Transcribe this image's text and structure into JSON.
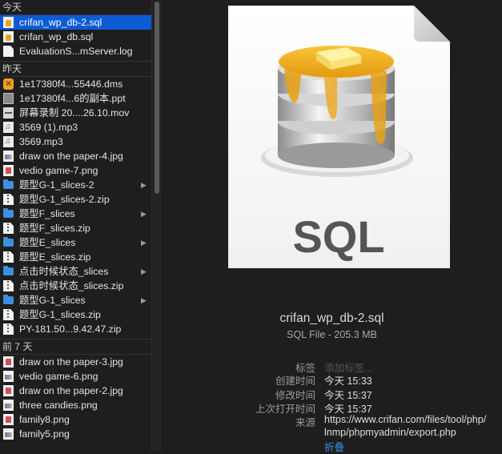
{
  "sidebar": {
    "sections": [
      {
        "header": "今天",
        "items": [
          {
            "label": "crifan_wp_db-2.sql",
            "icon": "sql-file-icon",
            "selected": true
          },
          {
            "label": "crifan_wp_db.sql",
            "icon": "sql-file-icon"
          },
          {
            "label": "EvaluationS...mServer.log",
            "icon": "document-icon"
          }
        ]
      },
      {
        "header": "昨天",
        "items": [
          {
            "label": "1e17380f4...55446.dms",
            "icon": "dms-file-icon"
          },
          {
            "label": "1e17380f4...6的副本.ppt",
            "icon": "ppt-file-icon"
          },
          {
            "label": "屏幕录制 20....26.10.mov",
            "icon": "movie-file-icon"
          },
          {
            "label": "3569 (1).mp3",
            "icon": "audio-file-icon"
          },
          {
            "label": "3569.mp3",
            "icon": "audio-file-icon"
          },
          {
            "label": "draw on the paper-4.jpg",
            "icon": "image-file-icon"
          },
          {
            "label": "vedio game-7.png",
            "icon": "image-file-icon"
          },
          {
            "label": "题型G-1_slices-2",
            "icon": "folder-icon",
            "folder": true
          },
          {
            "label": "题型G-1_slices-2.zip",
            "icon": "zip-file-icon"
          },
          {
            "label": "题型F_slices",
            "icon": "folder-icon",
            "folder": true
          },
          {
            "label": "题型F_slices.zip",
            "icon": "zip-file-icon"
          },
          {
            "label": "题型E_slices",
            "icon": "folder-icon",
            "folder": true
          },
          {
            "label": "题型E_slices.zip",
            "icon": "zip-file-icon"
          },
          {
            "label": "点击时候状态_slices",
            "icon": "folder-icon",
            "folder": true
          },
          {
            "label": "点击时候状态_slices.zip",
            "icon": "zip-file-icon"
          },
          {
            "label": "题型G-1_slices",
            "icon": "folder-icon",
            "folder": true
          },
          {
            "label": "题型G-1_slices.zip",
            "icon": "zip-file-icon"
          },
          {
            "label": "PY-181.50...9.42.47.zip",
            "icon": "zip-file-icon"
          }
        ]
      },
      {
        "header": "前 7 天",
        "items": [
          {
            "label": "draw on the paper-3.jpg",
            "icon": "image-file-icon"
          },
          {
            "label": "vedio game-6.png",
            "icon": "image-file-icon"
          },
          {
            "label": "draw on the paper-2.jpg",
            "icon": "image-file-icon"
          },
          {
            "label": "three candies.png",
            "icon": "image-file-icon"
          },
          {
            "label": "family8.png",
            "icon": "image-file-icon"
          },
          {
            "label": "family5.png",
            "icon": "image-file-icon"
          }
        ]
      }
    ]
  },
  "preview": {
    "icon_text": "SQL",
    "filename": "crifan_wp_db-2.sql",
    "kind_size": "SQL File - 205.3 MB",
    "details": [
      {
        "label": "标签",
        "value": "添加标签...",
        "style": "placeholder"
      },
      {
        "label": "创建时间",
        "value": "今天 15:33"
      },
      {
        "label": "修改时间",
        "value": "今天 15:37"
      },
      {
        "label": "上次打开时间",
        "value": "今天 15:37"
      },
      {
        "label": "来源",
        "value": "https://www.crifan.com/files/tool/php/lnmp/phpmyadmin/export.php",
        "value_lines": [
          "https://www.crifan.com/files/tool/php/",
          "lnmp/phpmyadmin/export.php"
        ]
      }
    ],
    "collapse_label": "折叠"
  }
}
